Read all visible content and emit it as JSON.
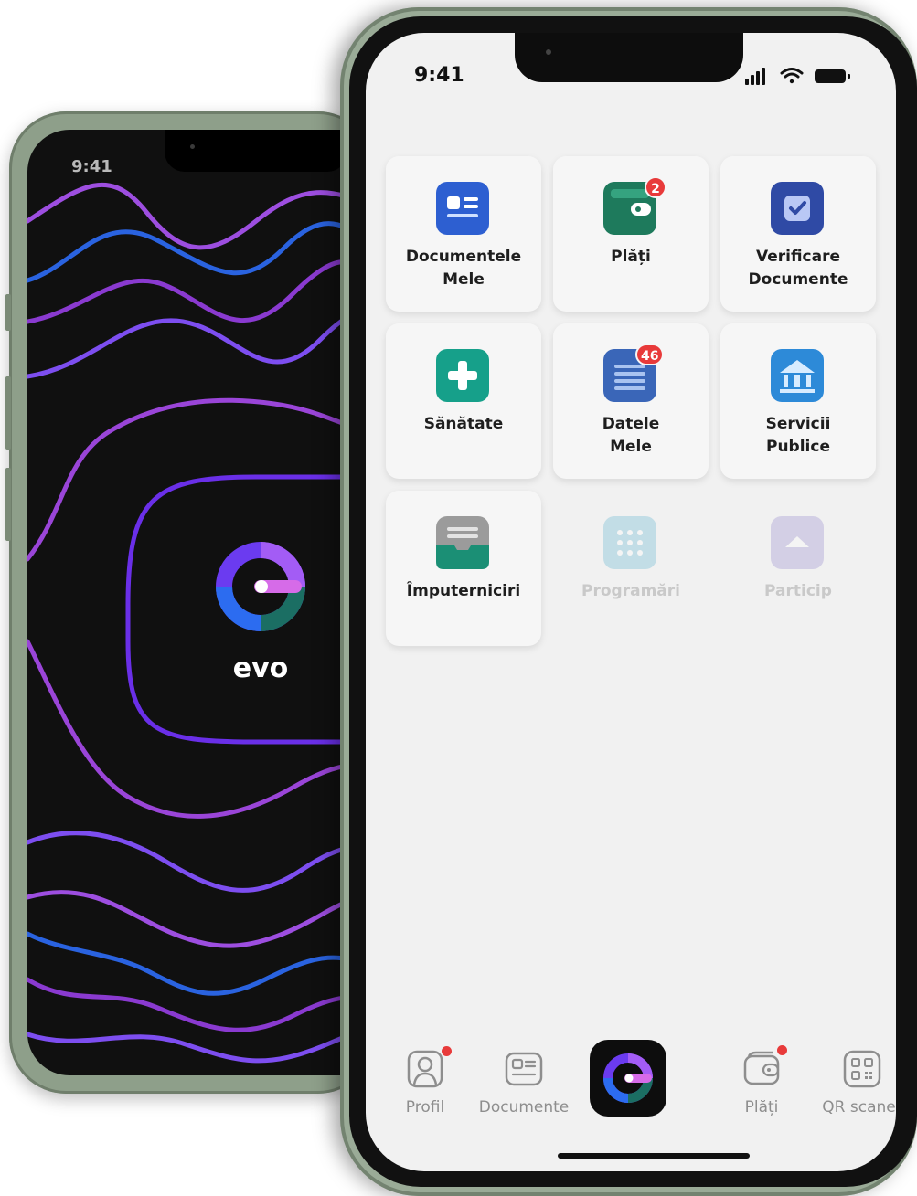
{
  "back_phone": {
    "time": "9:41",
    "app_name": "evo"
  },
  "front_phone": {
    "status": {
      "time": "9:41"
    },
    "tiles": [
      {
        "label": "Documentele\nMele",
        "icon": "id-card-icon",
        "color": "#2d5fd1"
      },
      {
        "label": "Plăți",
        "icon": "wallet-icon",
        "color": "#1e7a5c",
        "badge": "2"
      },
      {
        "label": "Verificare\nDocumente",
        "icon": "checkbox-icon",
        "color": "#2f4aa5"
      },
      {
        "label": "Sănătate",
        "icon": "health-plus-icon",
        "color": "#16a08a"
      },
      {
        "label": "Datele\nMele",
        "icon": "data-list-icon",
        "color": "#3a66b8",
        "badge": "46"
      },
      {
        "label": "Servicii\nPublice",
        "icon": "public-building-icon",
        "color": "#2d8ad8"
      },
      {
        "label": "Împuterniciri",
        "icon": "inbox-tray-icon",
        "color": "#1b8f75"
      },
      {
        "label": "Programări",
        "icon": "calendar-grid-icon",
        "color": "#3aa3c7"
      },
      {
        "label": "Particip",
        "icon": "participate-icon",
        "color": "#7c6dc2"
      }
    ],
    "nav": [
      {
        "label": "Profil",
        "icon": "profile-icon"
      },
      {
        "label": "Documente",
        "icon": "document-icon"
      },
      {
        "label": "Plăți",
        "icon": "wallet-icon"
      },
      {
        "label": "QR scaner",
        "icon": "qr-scanner-icon"
      }
    ]
  }
}
